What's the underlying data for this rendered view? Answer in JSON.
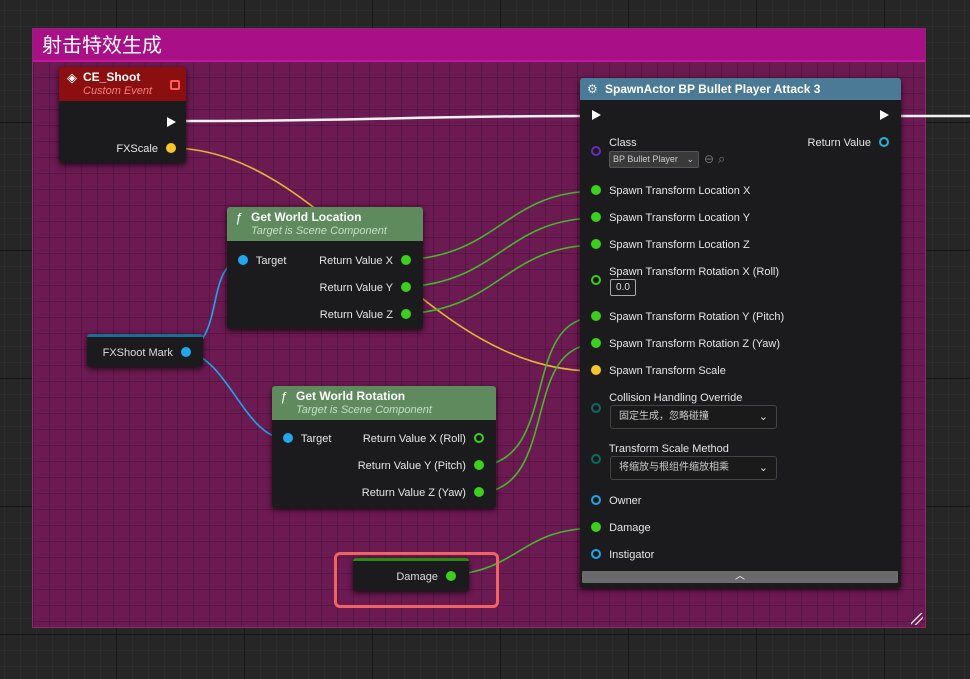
{
  "comment": {
    "title": "射击特效生成"
  },
  "event_node": {
    "title": "CE_Shoot",
    "subtitle": "Custom Event",
    "output_pin": "FXScale",
    "header_color": "#8b0f0f"
  },
  "get_world_location": {
    "title": "Get World Location",
    "subtitle": "Target is Scene Component",
    "input": "Target",
    "outputs": [
      "Return Value X",
      "Return Value Y",
      "Return Value Z"
    ],
    "header_color": "#5e8a5e"
  },
  "get_world_rotation": {
    "title": "Get World Rotation",
    "subtitle": "Target is Scene Component",
    "input": "Target",
    "outputs": [
      "Return Value X (Roll)",
      "Return Value Y (Pitch)",
      "Return Value Z (Yaw)"
    ],
    "header_color": "#5e8a5e"
  },
  "fxshoot_var": {
    "label": "FXShoot Mark"
  },
  "damage_var": {
    "label": "Damage"
  },
  "spawn_actor": {
    "title": "SpawnActor BP Bullet Player Attack 3",
    "header_color": "#4a7a96",
    "class_label": "Class",
    "class_value": "BP Bullet Player",
    "return_label": "Return Value",
    "pins": {
      "loc_x": "Spawn Transform Location X",
      "loc_y": "Spawn Transform Location Y",
      "loc_z": "Spawn Transform Location Z",
      "rot_x": "Spawn Transform Rotation X (Roll)",
      "rot_x_value": "0.0",
      "rot_y": "Spawn Transform Rotation Y (Pitch)",
      "rot_z": "Spawn Transform Rotation Z (Yaw)",
      "scale": "Spawn Transform Scale",
      "collision_label": "Collision Handling Override",
      "collision_value": "固定生成，忽略碰撞",
      "scale_method_label": "Transform Scale Method",
      "scale_method_value": "将缩放与根组件缩放相乘",
      "owner": "Owner",
      "damage": "Damage",
      "instigator": "Instigator"
    }
  }
}
